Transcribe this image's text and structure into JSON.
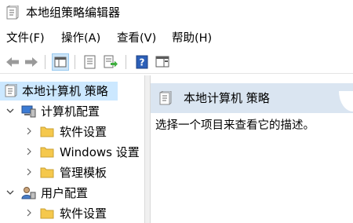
{
  "window": {
    "title": "本地组策略编辑器",
    "icon": "policy-doc-icon"
  },
  "menu": [
    {
      "label": "文件(F)"
    },
    {
      "label": "操作(A)"
    },
    {
      "label": "查看(V)"
    },
    {
      "label": "帮助(H)"
    }
  ],
  "toolbar": {
    "buttons": [
      {
        "name": "back-arrow-icon"
      },
      {
        "name": "forward-arrow-icon"
      },
      {
        "name": "show-hide-tree-icon",
        "active": true
      },
      {
        "name": "properties-icon"
      },
      {
        "name": "export-list-icon"
      },
      {
        "name": "help-icon"
      },
      {
        "name": "action-pane-icon"
      }
    ]
  },
  "tree": {
    "items": [
      {
        "label": "本地计算机 策略",
        "icon": "policy-doc-icon",
        "selected": true,
        "expander": "none"
      },
      {
        "label": "计算机配置",
        "icon": "computer-icon",
        "expander": "expanded"
      },
      {
        "label": "软件设置",
        "icon": "folder-icon",
        "expander": "collapsed"
      },
      {
        "label": "Windows 设置",
        "icon": "folder-icon",
        "expander": "collapsed"
      },
      {
        "label": "管理模板",
        "icon": "folder-icon",
        "expander": "collapsed"
      },
      {
        "label": "用户配置",
        "icon": "user-icon",
        "expander": "expanded"
      },
      {
        "label": "软件设置",
        "icon": "folder-icon",
        "expander": "collapsed"
      }
    ]
  },
  "details": {
    "title": "本地计算机 策略",
    "description": "选择一个项目来查看它的描述。"
  },
  "colors": {
    "selection": "#cce8ff",
    "header_band": "#dae5f1",
    "folder": "#f5c84c"
  }
}
